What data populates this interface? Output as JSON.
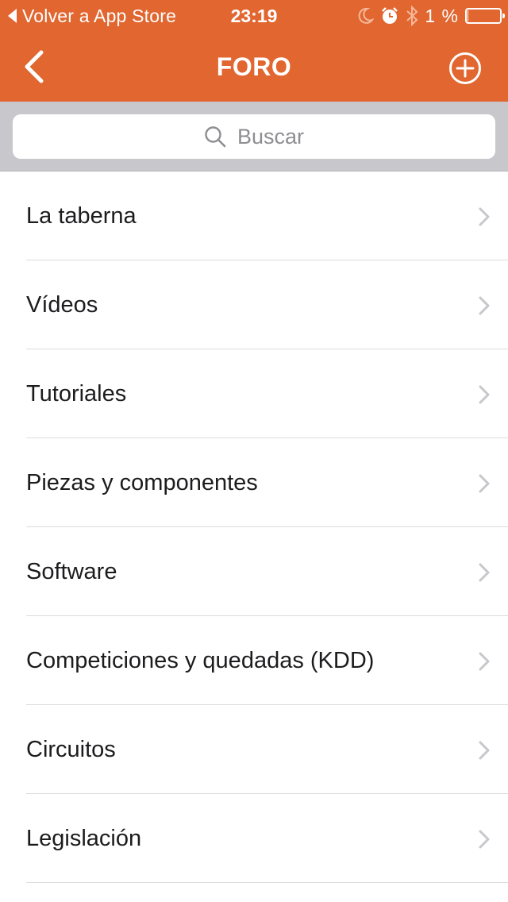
{
  "status_bar": {
    "back_to_app": "Volver a App Store",
    "time": "23:19",
    "battery_text": "1 %",
    "battery_level_percent": 1,
    "icons": [
      "moon-icon",
      "alarm-icon",
      "bluetooth-icon",
      "battery-icon"
    ]
  },
  "nav": {
    "title": "FORO",
    "back_icon": "chevron-left-icon",
    "add_icon": "plus-circle-icon"
  },
  "search": {
    "placeholder": "Buscar",
    "icon": "search-icon"
  },
  "categories": [
    {
      "label": "La taberna"
    },
    {
      "label": "Vídeos"
    },
    {
      "label": "Tutoriales"
    },
    {
      "label": "Piezas y componentes"
    },
    {
      "label": "Software"
    },
    {
      "label": "Competiciones y quedadas (KDD)"
    },
    {
      "label": "Circuitos"
    },
    {
      "label": "Legislación"
    }
  ],
  "colors": {
    "accent": "#e16630",
    "search_bg": "#c8c7cc",
    "chevron": "#c7c7cc",
    "separator": "#dcdce0"
  }
}
